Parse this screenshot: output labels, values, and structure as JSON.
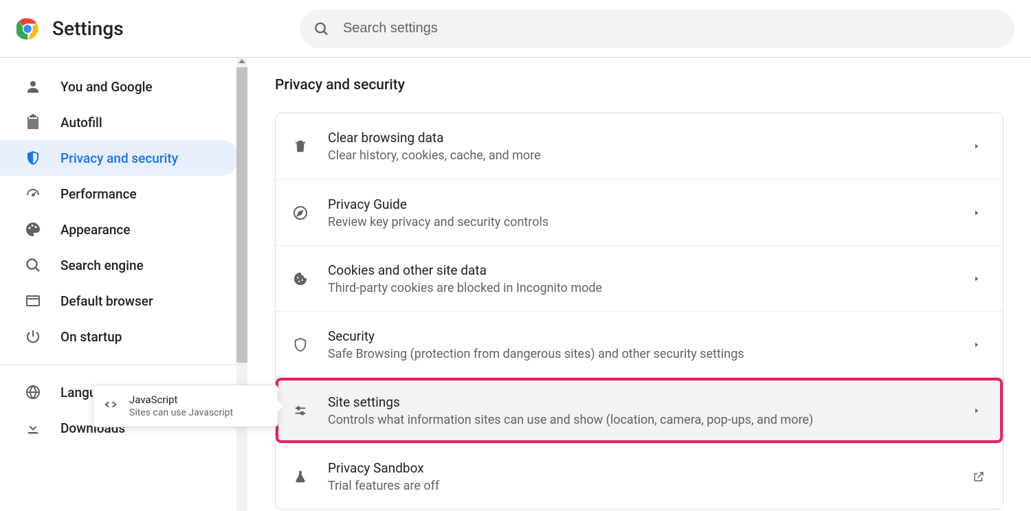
{
  "header": {
    "title": "Settings",
    "search_placeholder": "Search settings"
  },
  "sidebar": {
    "items": [
      {
        "label": "You and Google"
      },
      {
        "label": "Autofill"
      },
      {
        "label": "Privacy and security"
      },
      {
        "label": "Performance"
      },
      {
        "label": "Appearance"
      },
      {
        "label": "Search engine"
      },
      {
        "label": "Default browser"
      },
      {
        "label": "On startup"
      },
      {
        "label": "Languages"
      },
      {
        "label": "Downloads"
      }
    ]
  },
  "main": {
    "section_title": "Privacy and security",
    "rows": [
      {
        "title": "Clear browsing data",
        "sub": "Clear history, cookies, cache, and more"
      },
      {
        "title": "Privacy Guide",
        "sub": "Review key privacy and security controls"
      },
      {
        "title": "Cookies and other site data",
        "sub": "Third-party cookies are blocked in Incognito mode"
      },
      {
        "title": "Security",
        "sub": "Safe Browsing (protection from dangerous sites) and other security settings"
      },
      {
        "title": "Site settings",
        "sub": "Controls what information sites can use and show (location, camera, pop-ups, and more)"
      },
      {
        "title": "Privacy Sandbox",
        "sub": "Trial features are off"
      }
    ]
  },
  "tooltip": {
    "title": "JavaScript",
    "sub": "Sites can use Javascript"
  }
}
